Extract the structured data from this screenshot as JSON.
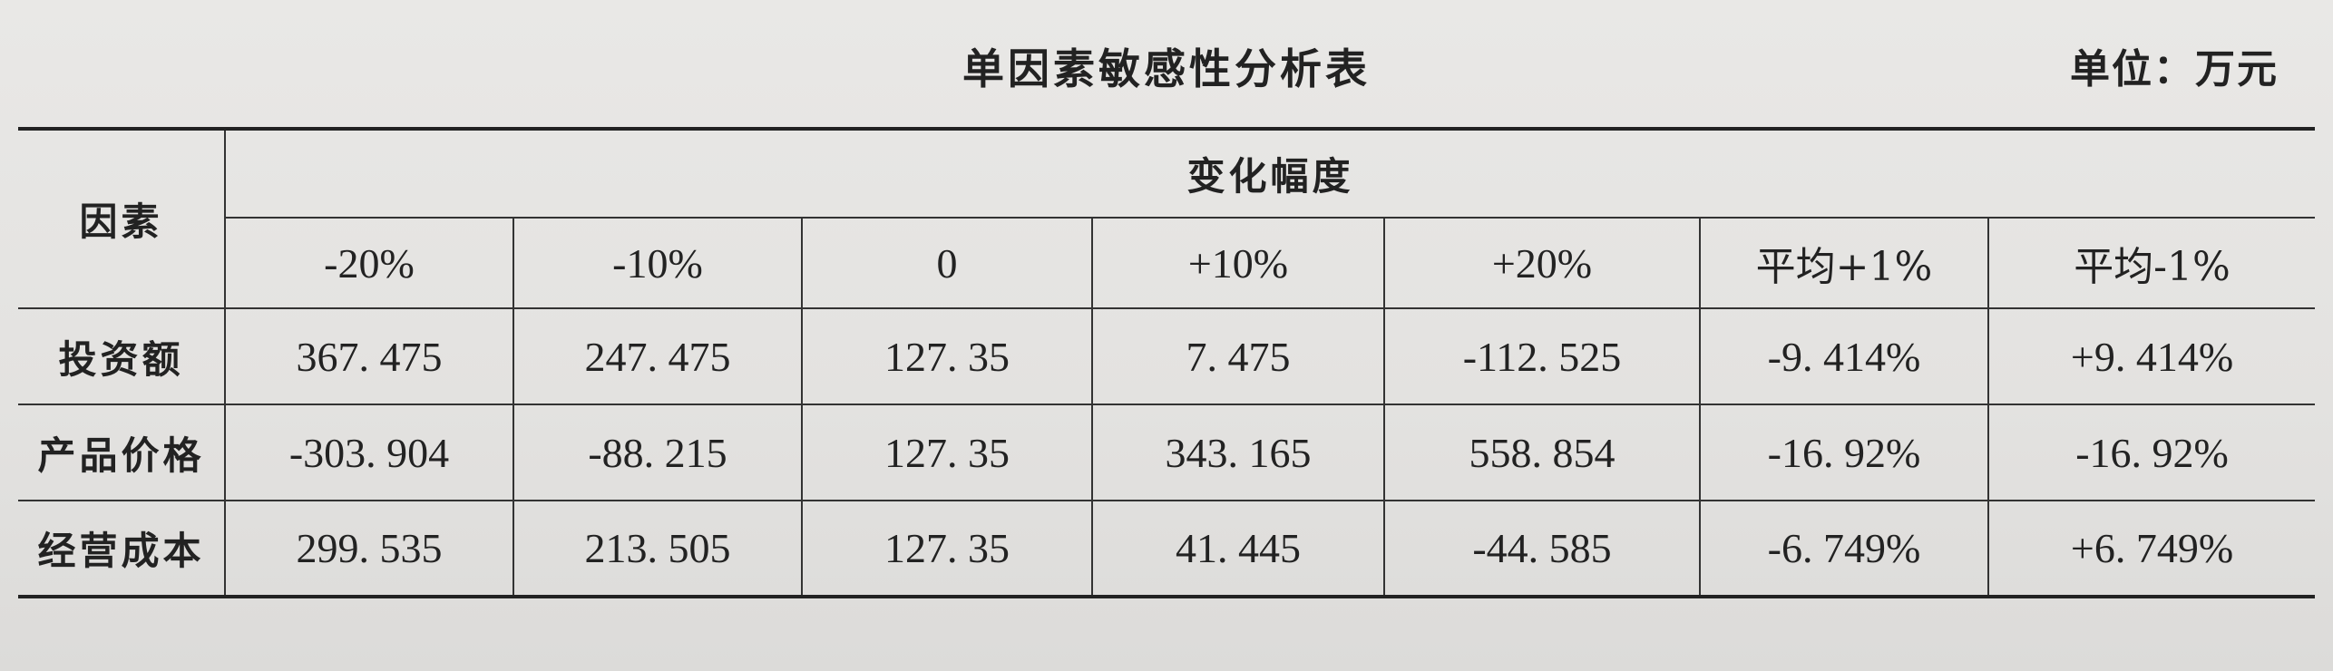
{
  "title": "单因素敏感性分析表",
  "unit": "单位：万元",
  "table": {
    "factor_header": "因素",
    "change_header": "变化幅度",
    "columns": [
      "-20%",
      "-10%",
      "0",
      "+10%",
      "+20%",
      "平均+1%",
      "平均-1%"
    ],
    "rows": [
      {
        "label": "投资额",
        "cells": [
          "367. 475",
          "247. 475",
          "127. 35",
          "7. 475",
          "-112. 525",
          "-9. 414%",
          "+9. 414%"
        ]
      },
      {
        "label": "产品价格",
        "cells": [
          "-303. 904",
          "-88. 215",
          "127. 35",
          "343. 165",
          "558. 854",
          "-16. 92%",
          "-16. 92%"
        ]
      },
      {
        "label": "经营成本",
        "cells": [
          "299. 535",
          "213. 505",
          "127. 35",
          "41. 445",
          "-44. 585",
          "-6. 749%",
          "+6. 749%"
        ]
      }
    ]
  }
}
